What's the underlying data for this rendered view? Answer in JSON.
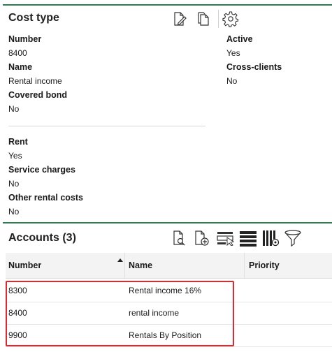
{
  "cost_type": {
    "title": "Cost type",
    "fields": {
      "number": {
        "label": "Number",
        "value": "8400"
      },
      "name": {
        "label": "Name",
        "value": "Rental income"
      },
      "covered_bond": {
        "label": "Covered bond",
        "value": "No"
      },
      "active": {
        "label": "Active",
        "value": "Yes"
      },
      "cross_clients": {
        "label": "Cross-clients",
        "value": "No"
      },
      "rent": {
        "label": "Rent",
        "value": "Yes"
      },
      "service_charges": {
        "label": "Service charges",
        "value": "No"
      },
      "other_rental_costs": {
        "label": "Other rental costs",
        "value": "No"
      }
    },
    "toolbar": [
      "edit-document-icon",
      "copy-document-icon",
      "gear-icon"
    ]
  },
  "accounts": {
    "title": "Accounts (3)",
    "toolbar": [
      "search-document-icon",
      "add-document-icon",
      "select-row-icon",
      "list-view-icon",
      "column-settings-icon",
      "filter-icon"
    ],
    "columns": [
      "Number",
      "Name",
      "Priority"
    ],
    "sorted_column": "Number",
    "rows": [
      {
        "number": "8300",
        "name": "Rental income 16%",
        "priority": ""
      },
      {
        "number": "8400",
        "name": "rental income",
        "priority": ""
      },
      {
        "number": "9900",
        "name": "Rentals By Position",
        "priority": ""
      }
    ]
  },
  "colors": {
    "accent": "#2e7d4f",
    "highlight": "#e0282e"
  }
}
